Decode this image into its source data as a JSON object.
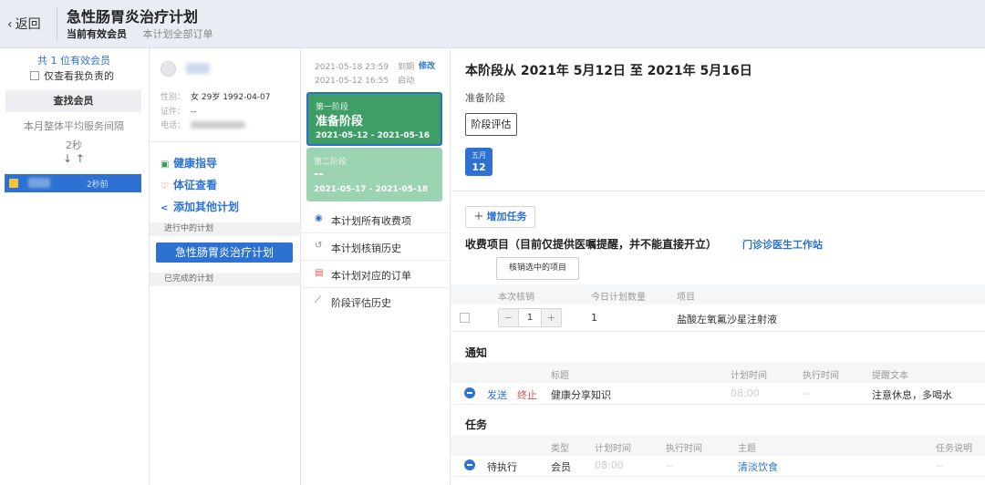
{
  "header": {
    "back_label": "返回",
    "title": "急性肠胃炎治疗计划",
    "tab_active": "当前有效会员",
    "tab_orders": "本计划全部订单"
  },
  "member_panel": {
    "count_text": "共 1 位有效会员",
    "only_mine_label": "仅查看我负责的",
    "find_member_button": "查找会员",
    "avg_service_label": "本月整体平均服务间隔",
    "avg_service_value": "2秒",
    "sort_arrows": "↓ ↑",
    "member_time": "2秒前"
  },
  "profile": {
    "gender_label": "性别：",
    "gender_value": "女 29岁 1992-04-07",
    "id_label": "证件：",
    "id_value": "--",
    "phone_label": "电话：",
    "actions": {
      "health_guide": "健康指导",
      "vitals": "体征查看",
      "add_plan": "添加其他计划"
    },
    "in_progress_label": "进行中的计划",
    "current_plan": "急性肠胃炎治疗计划",
    "completed_label": "已完成的计划"
  },
  "plan_col": {
    "date1": "2021-05-18 23:59",
    "date1_tag": "到期",
    "date2": "2021-05-12 16:55",
    "date2_tag": "启动",
    "edit_label": "修改",
    "stage1": {
      "small": "第一阶段",
      "name": "准备阶段",
      "range": "2021-05-12 - 2021-05-16"
    },
    "stage2": {
      "small": "第二阶段",
      "name": "--",
      "range": "2021-05-17 - 2021-05-18"
    },
    "menu": [
      {
        "label": "本计划所有收费项"
      },
      {
        "label": "本计划核销历史"
      },
      {
        "label": "本计划对应的订单"
      },
      {
        "label": "阶段评估历史"
      }
    ]
  },
  "detail": {
    "stage_title": "本阶段从 2021年 5月12日 至 2021年 5月16日",
    "stage_name": "准备阶段",
    "eval_button": "阶段评估",
    "cal_month": "五月",
    "cal_day": "12",
    "add_task_button": "增加任务",
    "charges_title": "收费项目（目前仅提供医嘱提醒，并不能直接开立）",
    "clinic_link": "门诊诊医生工作站",
    "void_button": "核销选中的项目",
    "charges_headers": [
      "本次核销",
      "今日计划数量",
      "项目"
    ],
    "charges_row": {
      "qty": "1",
      "planned": "1",
      "item": "盐酸左氧氟沙星注射液"
    },
    "notice_title": "通知",
    "notice_headers": [
      "标题",
      "计划时间",
      "执行时间",
      "提醒文本"
    ],
    "notice_row": {
      "send": "发送",
      "stop": "终止",
      "title": "健康分享知识",
      "plan_time": "08:00",
      "exec_time": "--",
      "text": "注意休息，多喝水"
    },
    "task_title": "任务",
    "task_headers": [
      "类型",
      "计划时间",
      "执行时间",
      "主题",
      "任务说明"
    ],
    "task_row": {
      "status": "待执行",
      "type": "会员",
      "plan_time": "08:00",
      "exec_time": "--",
      "topic": "清淡饮食",
      "desc": "--"
    }
  }
}
